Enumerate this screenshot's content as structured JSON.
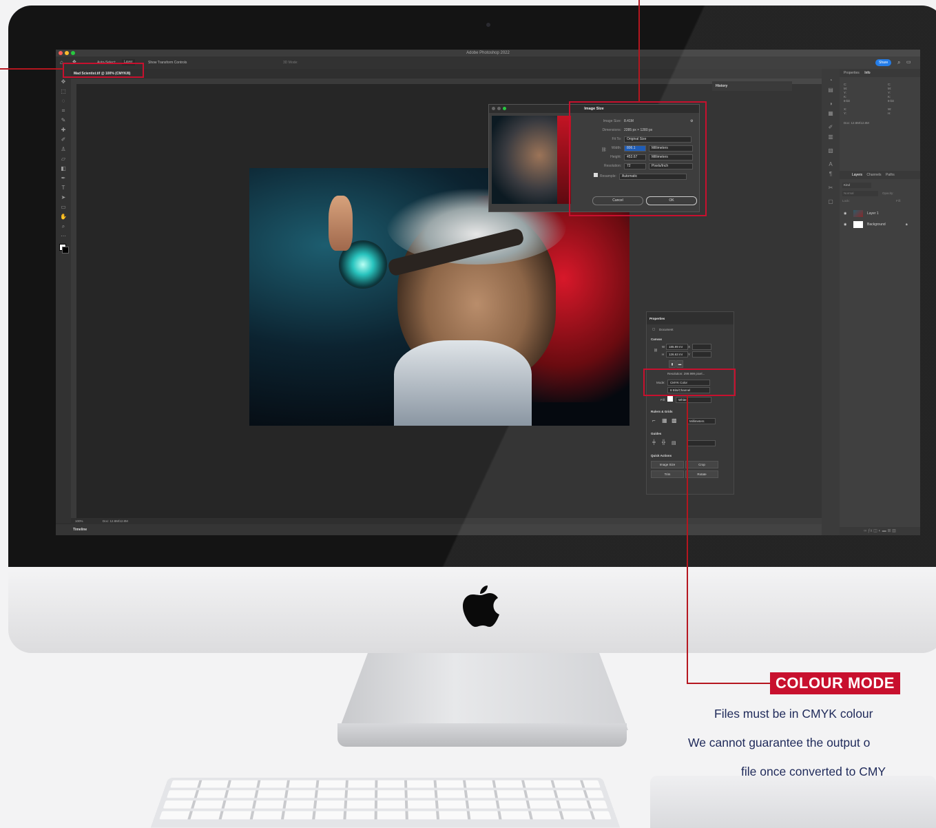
{
  "app": {
    "window_title": "Adobe Photoshop 2022",
    "share_label": "Share",
    "options_bar": {
      "auto_select_label": "Auto-Select:",
      "auto_select_value": "Layer",
      "show_transform_label": "Show Transform Controls",
      "mode_3d_label": "3D Mode:"
    },
    "document_tab": "Mad Scientist.tif @ 100% (CMYK/8)",
    "status": {
      "zoom": "100%",
      "doc_size": "Doc: 12.8M/12.8M"
    },
    "timeline_label": "Timeline",
    "history_label": "History"
  },
  "image_size_dialog": {
    "title": "Image Size",
    "image_size_label": "Image Size:",
    "image_size_value": "8.41M",
    "dimensions_label": "Dimensions:",
    "dimensions_value": "2285 px  ×  1280 px",
    "fit_to_label": "Fit To:",
    "fit_to_value": "Original Size",
    "width_label": "Width:",
    "width_value": "806.1",
    "width_unit": "Millimeters",
    "height_label": "Height:",
    "height_value": "453.67",
    "height_unit": "Millimeters",
    "resolution_label": "Resolution:",
    "resolution_value": "72",
    "resolution_unit": "Pixels/Inch",
    "resample_label": "Resample:",
    "resample_value": "Automatic",
    "cancel_label": "Cancel",
    "ok_label": "OK"
  },
  "right_panel": {
    "tabs": [
      "Properties",
      "Info"
    ],
    "info": {
      "c": "C:",
      "m": "M:",
      "y": "Y:",
      "k": "K:",
      "bits": "8-bit",
      "x": "X:",
      "yy": "Y:",
      "w": "W:",
      "h": "H:",
      "doc": "Doc: 12.8M/12.8M"
    },
    "layer_tabs": [
      "Layers",
      "Channels",
      "Paths"
    ],
    "kind_label": "Kind",
    "blend_mode": "Normal",
    "opacity_label": "Opacity:",
    "lock_label": "Lock:",
    "fill_label": "Fill:",
    "layers": [
      {
        "name": "Layer 1"
      },
      {
        "name": "Background"
      }
    ]
  },
  "properties_panel": {
    "title": "Properties",
    "document_label": "Document",
    "canvas_label": "Canvas",
    "w_label": "W",
    "w_value": "185.99 mr",
    "h_label": "H",
    "h_value": "126.63 mr",
    "x_label": "X",
    "y_label": "Y",
    "resolution_text": "Resolution: 299.999 pixel...",
    "mode_label": "Mode:",
    "mode_value": "CMYK Color",
    "depth_value": "8 Bits/Channel",
    "fill_label": "Fill:",
    "fill_value": "White",
    "rulers_label": "Rulers & Grids",
    "rulers_unit": "Millimeters",
    "guides_label": "Guides",
    "quick_actions_label": "Quick Actions",
    "qa_image_size": "Image Size",
    "qa_crop": "Crop",
    "qa_trim": "Trim",
    "qa_rotate": "Rotate"
  },
  "callout": {
    "title": "COLOUR MODE",
    "line1": "Files must be in CMYK colour",
    "line2": "We cannot guarantee the output o",
    "line3": "file once converted to CMY",
    "accent": "#c8102e",
    "text_color": "#1f2a5a"
  }
}
